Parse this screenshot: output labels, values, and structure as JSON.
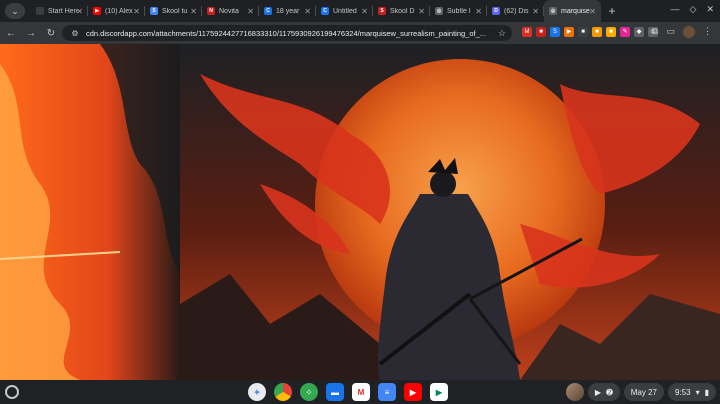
{
  "tabs": [
    {
      "title": "Start Here",
      "icon": "",
      "color": "#3c3d41"
    },
    {
      "title": "(10) Alex",
      "icon": "▶",
      "color": "#ff0000"
    },
    {
      "title": "Skool tu",
      "icon": "S",
      "color": "#4285f4"
    },
    {
      "title": "Novita",
      "icon": "N",
      "color": "#c5221f"
    },
    {
      "title": "18 year",
      "icon": "C",
      "color": "#1a73e8"
    },
    {
      "title": "Untitled",
      "icon": "C",
      "color": "#1a73e8"
    },
    {
      "title": "Skool D",
      "icon": "S",
      "color": "#c5221f"
    },
    {
      "title": "Subtle I",
      "icon": "◎",
      "color": "#5f6368"
    },
    {
      "title": "(62) Dis",
      "icon": "D",
      "color": "#5865f2"
    },
    {
      "title": "marquise",
      "icon": "◎",
      "color": "#5f6368",
      "active": true
    }
  ],
  "toolbar": {
    "url": "cdn.discordapp.com/attachments/1175924427716833310/1175930926199476324/marquisew_surrealism_painting_of_..."
  },
  "extensions": [
    {
      "icon": "ext-red",
      "color": "#d93025",
      "label": "M"
    },
    {
      "icon": "ext-red2",
      "color": "#c5221f",
      "label": "■"
    },
    {
      "icon": "ext-blue",
      "color": "#1a73e8",
      "label": "S"
    },
    {
      "icon": "ext-orange",
      "color": "#e8710a",
      "label": "▶"
    },
    {
      "icon": "ext-dark",
      "color": "#3c4043",
      "label": "■"
    },
    {
      "icon": "ext-amber",
      "color": "#f29900",
      "label": "■"
    },
    {
      "icon": "ext-amber2",
      "color": "#f9ab00",
      "label": "■"
    },
    {
      "icon": "ext-pink",
      "color": "#e52592",
      "label": "✎"
    },
    {
      "icon": "ext-gray",
      "color": "#5f6368",
      "label": "◆"
    },
    {
      "icon": "ext-gray2",
      "color": "#5f6368",
      "label": "◎"
    }
  ],
  "shelf": {
    "date": "May 27",
    "time": "9:53",
    "apps": [
      {
        "name": "assistant",
        "label": "✦",
        "color": "#e8eaed",
        "sq": false,
        "fg": "#4285f4"
      },
      {
        "name": "chrome",
        "label": "",
        "color": "conic",
        "sq": false,
        "fg": "#fff"
      },
      {
        "name": "app-grid",
        "label": "⁘",
        "color": "#34a853",
        "sq": false,
        "fg": "#fff"
      },
      {
        "name": "files",
        "label": "▬",
        "color": "#1a73e8",
        "sq": true,
        "fg": "#fff"
      },
      {
        "name": "gmail",
        "label": "M",
        "color": "#ffffff",
        "sq": true,
        "fg": "#d93025"
      },
      {
        "name": "docs",
        "label": "≡",
        "color": "#4285f4",
        "sq": true,
        "fg": "#fff"
      },
      {
        "name": "youtube",
        "label": "▶",
        "color": "#ff0000",
        "sq": true,
        "fg": "#fff"
      },
      {
        "name": "play-store",
        "label": "▶",
        "color": "#ffffff",
        "sq": true,
        "fg": "#01875f"
      }
    ]
  },
  "image": {
    "subject": "samurai-painting-icon"
  }
}
